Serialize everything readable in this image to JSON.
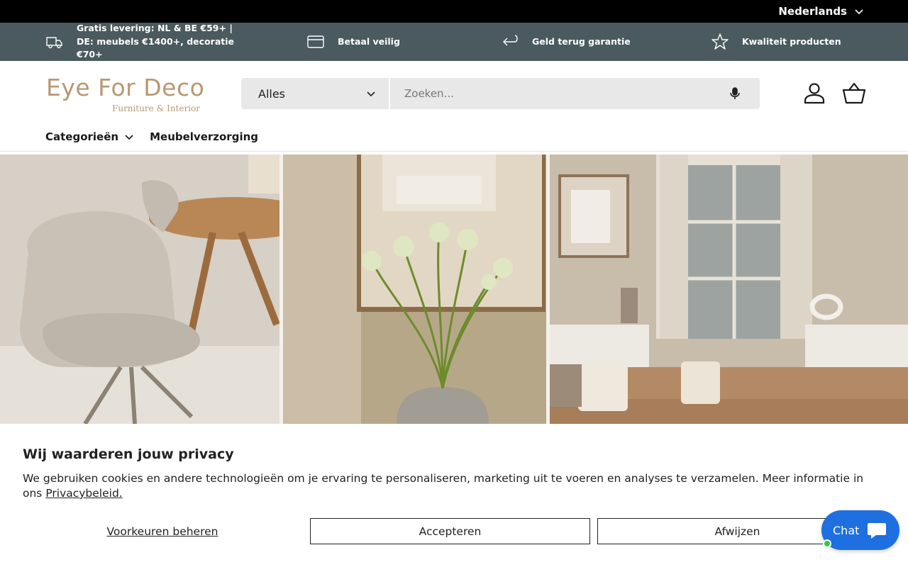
{
  "topbar": {
    "language": "Nederlands"
  },
  "usps": [
    {
      "icon": "truck-icon",
      "text": "Gratis levering: NL & BE €59+ | DE: meubels €1400+, decoratie €70+"
    },
    {
      "icon": "credit-card-icon",
      "text": "Betaal veilig"
    },
    {
      "icon": "return-arrow-icon",
      "text": "Geld terug garantie"
    },
    {
      "icon": "star-icon",
      "text": "Kwaliteit producten"
    }
  ],
  "header": {
    "logo_main": "Eye For Deco",
    "logo_sub": "Furniture & Interior",
    "search_category": "Alles",
    "search_placeholder": "Zoeken..."
  },
  "nav": {
    "items": [
      {
        "label": "Categorieën",
        "has_dropdown": true
      },
      {
        "label": "Meubelverzorging",
        "has_dropdown": false
      }
    ]
  },
  "cookie": {
    "title": "Wij waarderen jouw privacy",
    "text": "We gebruiken cookies en andere technologieën om je ervaring te personaliseren, marketing uit te voeren en analyses te verzamelen. Meer informatie in ons ",
    "link": "Privacybeleid.",
    "prefs_label": "Voorkeuren beheren",
    "accept_label": "Accepteren",
    "decline_label": "Afwijzen"
  },
  "chat": {
    "label": "Chat"
  },
  "colors": {
    "topbar": "#000000",
    "uspbar": "#4a5a5e",
    "logo": "#b89872",
    "chat": "#1e6fe0",
    "online": "#2ecc40"
  }
}
